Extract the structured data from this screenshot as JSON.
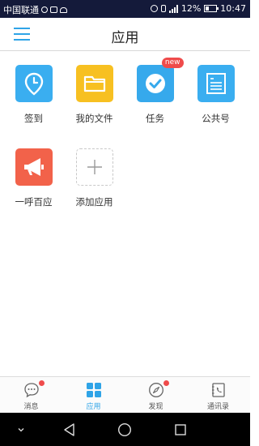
{
  "status_bar": {
    "carrier": "中国联通",
    "battery": "12%",
    "time": "10:47"
  },
  "header": {
    "title": "应用",
    "menu_icon": "hamburger-icon"
  },
  "apps": [
    {
      "label": "签到",
      "icon": "location-pin-icon",
      "color": "#3aaef0"
    },
    {
      "label": "我的文件",
      "icon": "folder-icon",
      "color": "#f7c021"
    },
    {
      "label": "任务",
      "icon": "checkmark-icon",
      "color": "#36a9ec",
      "badge": "new"
    },
    {
      "label": "公共号",
      "icon": "document-icon",
      "color": "#3aaef0"
    },
    {
      "label": "一呼百应",
      "icon": "megaphone-icon",
      "color": "#f2624a"
    },
    {
      "label": "添加应用",
      "icon": "plus-icon",
      "color": "#ffffff"
    }
  ],
  "tabbar": {
    "tabs": [
      {
        "label": "消息",
        "icon": "chat-bubble-icon",
        "dot": true
      },
      {
        "label": "应用",
        "icon": "grid-icon",
        "active": true
      },
      {
        "label": "发现",
        "icon": "compass-icon",
        "dot": true
      },
      {
        "label": "通讯录",
        "icon": "phone-book-icon"
      }
    ],
    "accent": "#2fa4e7"
  },
  "colors": {
    "status_bar_bg": "#141a3a",
    "badge_red": "#ef4b4b"
  }
}
